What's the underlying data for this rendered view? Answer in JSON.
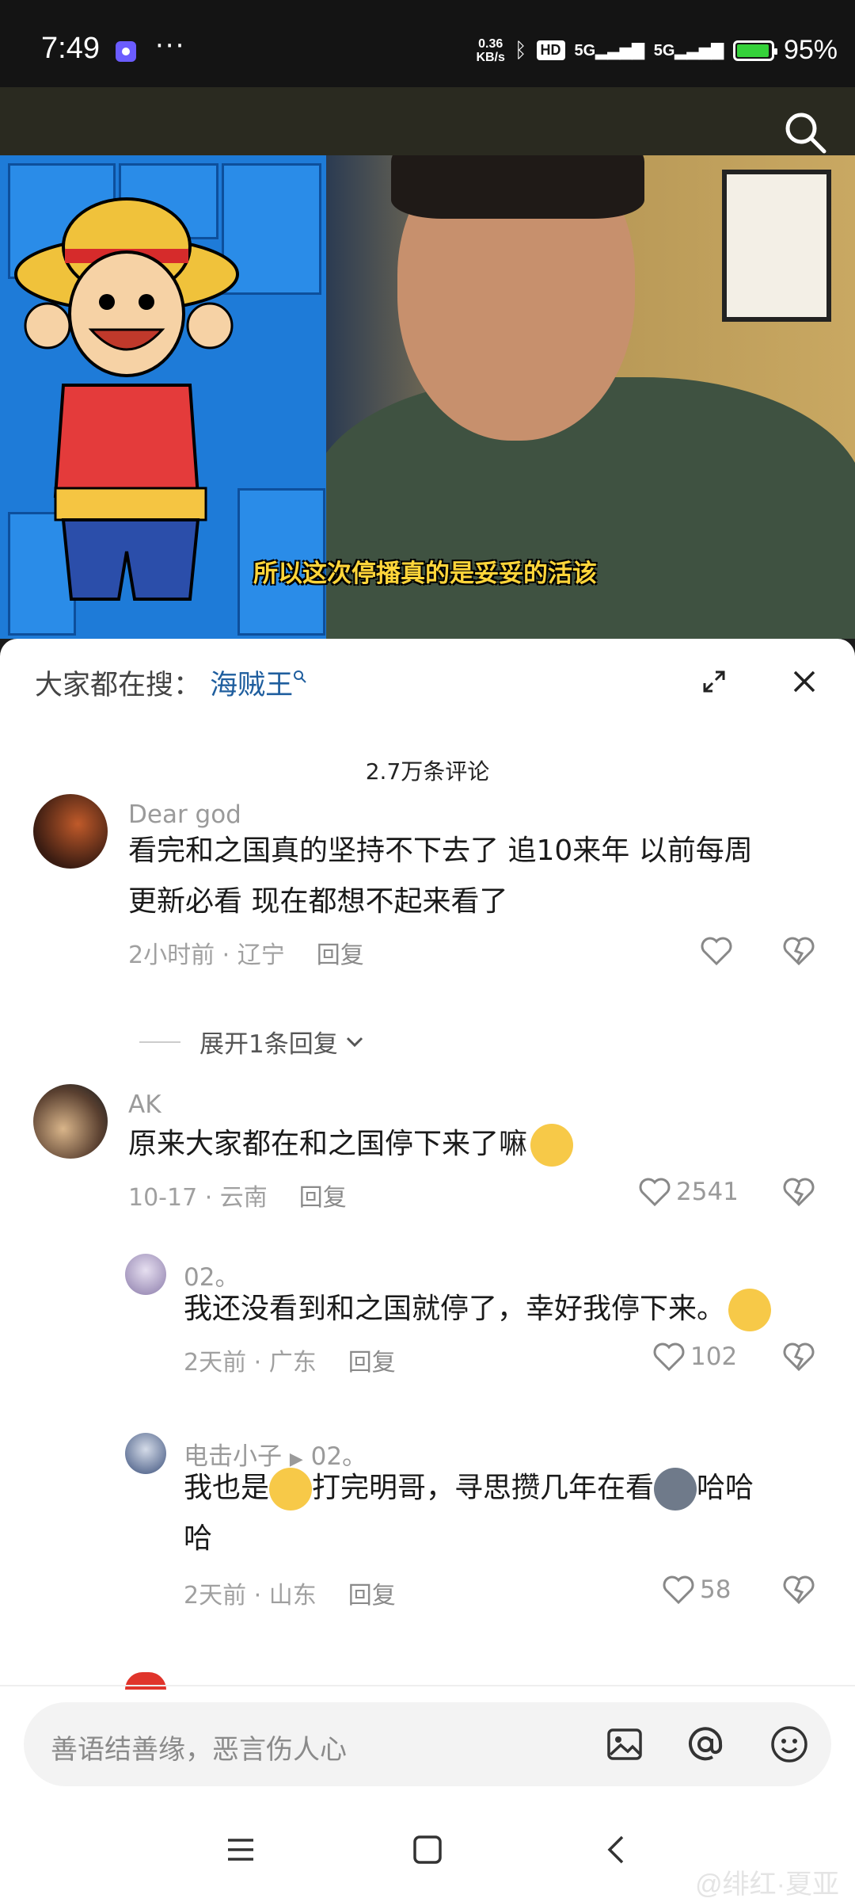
{
  "status_bar": {
    "time": "7:49",
    "speed_line1": "0.36",
    "speed_line2": "KB/s",
    "hd": "HD",
    "net1": "5G",
    "net2": "5G",
    "battery": "95%",
    "battery_level": 0.95,
    "dots": "···"
  },
  "video": {
    "subtitle": "所以这次停播真的是妥妥的活该"
  },
  "sheet": {
    "hot_search_label": "大家都在搜：",
    "hot_search_term": "海贼王",
    "comment_count": "2.7万条评论"
  },
  "comments": [
    {
      "user": "Dear god",
      "text1": "看完和之国真的坚持不下去了 追10来年 以前每周",
      "text2": "更新必看 现在都想不起来看了",
      "time": "2小时前",
      "location": "辽宁",
      "reply": "回复",
      "expand": "展开1条回复"
    },
    {
      "user": "AK",
      "text": "原来大家都在和之国停下来了嘛",
      "time": "10-17",
      "location": "云南",
      "reply": "回复",
      "likes": "2541"
    },
    {
      "user": "02。",
      "text": "我还没看到和之国就停了，幸好我停下来。",
      "time": "2天前",
      "location": "广东",
      "reply": "回复",
      "likes": "102"
    },
    {
      "user": "电击小子",
      "reply_to": "02。",
      "text1a": "我也是",
      "text1b": "打完明哥，寻思攒几年在看",
      "text1c": "哈哈",
      "text2": "哈",
      "time": "2天前",
      "location": "山东",
      "reply": "回复",
      "likes": "58"
    }
  ],
  "input": {
    "placeholder": "善语结善缘，恶言伤人心"
  },
  "watermark": "@绯红·夏亚",
  "colors": {
    "accent_link": "#1f5e9e",
    "battery_green": "#35d23a",
    "subtitle_yellow": "#ffd53a"
  }
}
